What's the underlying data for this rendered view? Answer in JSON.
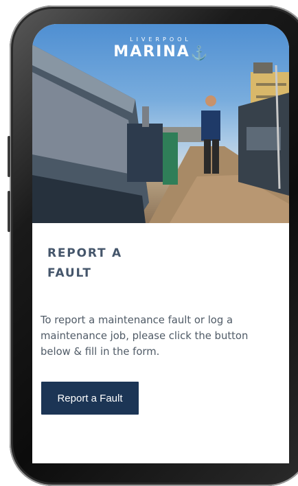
{
  "logo": {
    "top_text": "LIVERPOOL",
    "main_text": "MARINA",
    "icon": "anchor-icon"
  },
  "hero": {
    "description_icon": "marina-photo"
  },
  "content": {
    "heading_line1": "REPORT A",
    "heading_line2": "FAULT",
    "body": "To report a maintenance fault or log a maintenance job, please click the button below & fill in the form.",
    "cta_label": "Report a Fault"
  },
  "colors": {
    "heading": "#45566b",
    "body_text": "#4f5a66",
    "button_bg": "#1c3555",
    "button_text": "#ffffff"
  }
}
